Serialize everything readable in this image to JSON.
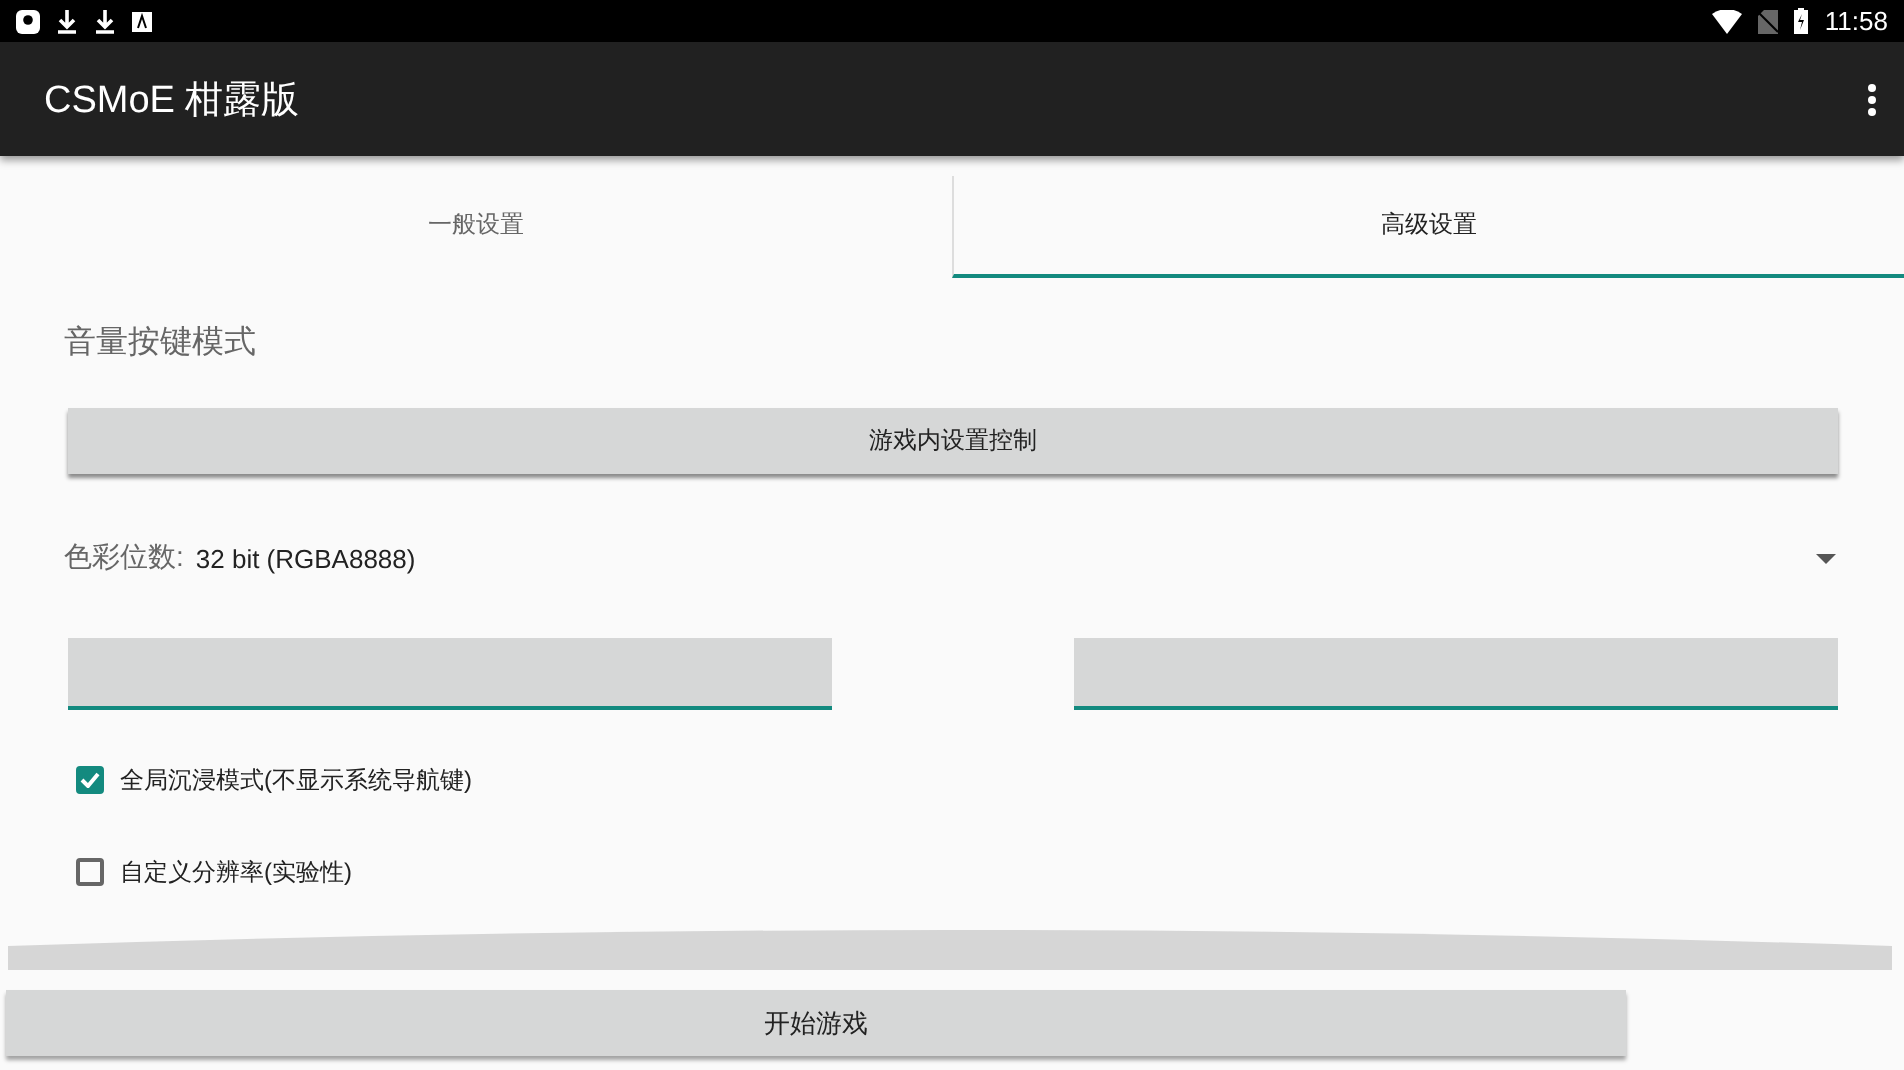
{
  "status_bar": {
    "time": "11:58"
  },
  "app_bar": {
    "title": "CSMoE 柑露版"
  },
  "tabs": [
    {
      "label": "一般设置",
      "selected": false
    },
    {
      "label": "高级设置",
      "selected": true
    }
  ],
  "section_title": "音量按键模式",
  "volume_button": "游戏内设置控制",
  "color_depth": {
    "label": "色彩位数:",
    "value": "32 bit (RGBA8888)"
  },
  "fields": [
    {
      "kind": "text"
    },
    {
      "kind": "text"
    }
  ],
  "checkboxes": [
    {
      "label": "全局沉浸模式(不显示系统导航键)",
      "checked": true
    },
    {
      "label": "自定义分辨率(实验性)",
      "checked": false
    }
  ],
  "start_button": "开始游戏"
}
